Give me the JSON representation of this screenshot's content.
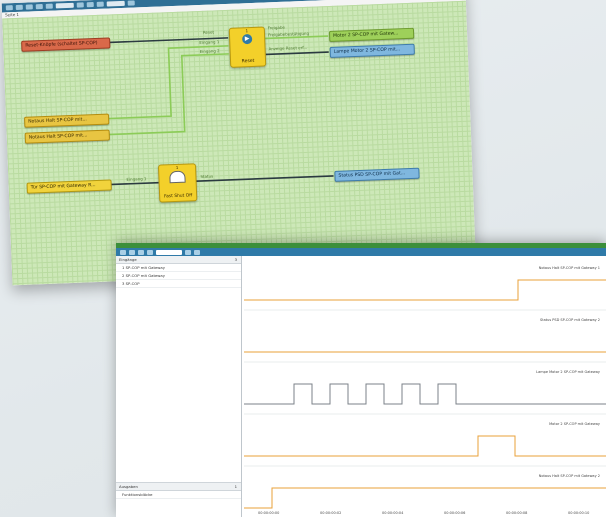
{
  "editor": {
    "tab_label": "Seite 1",
    "nodes": [
      {
        "id": "n1",
        "label": "Reset-Knöpfe (schaltet SP-COP)",
        "color": "red"
      },
      {
        "id": "n2",
        "label": "Notaus Halt SP-COP mit...",
        "color": "orange"
      },
      {
        "id": "n3",
        "label": "Notaus Halt SP-COP mit...",
        "color": "orange"
      },
      {
        "id": "n4",
        "label": "Tür SP-COP mit Gateway R...",
        "color": "yellow"
      },
      {
        "id": "n5",
        "label": "Motor 2 SP-COP mit Gatew...",
        "color": "green"
      },
      {
        "id": "n6",
        "label": "Lampe Motor 2 SP-COP mit...",
        "color": "blue"
      },
      {
        "id": "n7",
        "label": "Status PSD SP-COP mit Gat...",
        "color": "blue"
      }
    ],
    "blocks": [
      {
        "id": "reset",
        "label": "Reset",
        "index": "1"
      },
      {
        "id": "fso",
        "label": "Fast Shut Off",
        "index": "1"
      }
    ],
    "port_labels": {
      "reset_in": [
        "Reset",
        "Eingang 1",
        "Eingang 2"
      ],
      "reset_out": [
        "Freigabe",
        "Freigabebestätigung",
        "Anzeige Reset erf..."
      ],
      "fso_in": "Eingang 1",
      "fso_out": "Status"
    }
  },
  "viewer": {
    "side_header": "Eingänge",
    "side_count": "3",
    "side_items": [
      "1  SP-COP mit Gateway",
      "2  SP-COP mit Gateway",
      "3  SP-COP"
    ],
    "bottom_header": "Ausgaben",
    "bottom_count": "1",
    "bottom_item": "Funktionsblöcke",
    "lanes": [
      {
        "label": "Notaus Halt SP-COP mit Gateway 1",
        "color": "orange"
      },
      {
        "label": "Status PSD SP-COP mit Gateway 2",
        "color": "orange"
      },
      {
        "label": "Lampe Motor 2 SP-COP mit Gateway",
        "color": "gray"
      },
      {
        "label": "Motor 2 SP-COP mit Gateway",
        "color": "orange"
      },
      {
        "label": "Notaus Halt SP-COP mit Gateway 2",
        "color": "orange"
      }
    ],
    "time_ticks": [
      "00:00:00:00",
      "00:00:00:02",
      "00:00:00:04",
      "00:00:00:06",
      "00:00:00:08",
      "00:00:00:10"
    ]
  },
  "colors": {
    "canvas_green": "#cde8b8",
    "wire_dark": "#2b3a40",
    "wire_green": "#8ccc58",
    "signal_orange": "#e8a03a",
    "signal_gray": "#7b8288",
    "toolbar_blue": "#2f7aa8",
    "title_green": "#3c8f3b"
  }
}
